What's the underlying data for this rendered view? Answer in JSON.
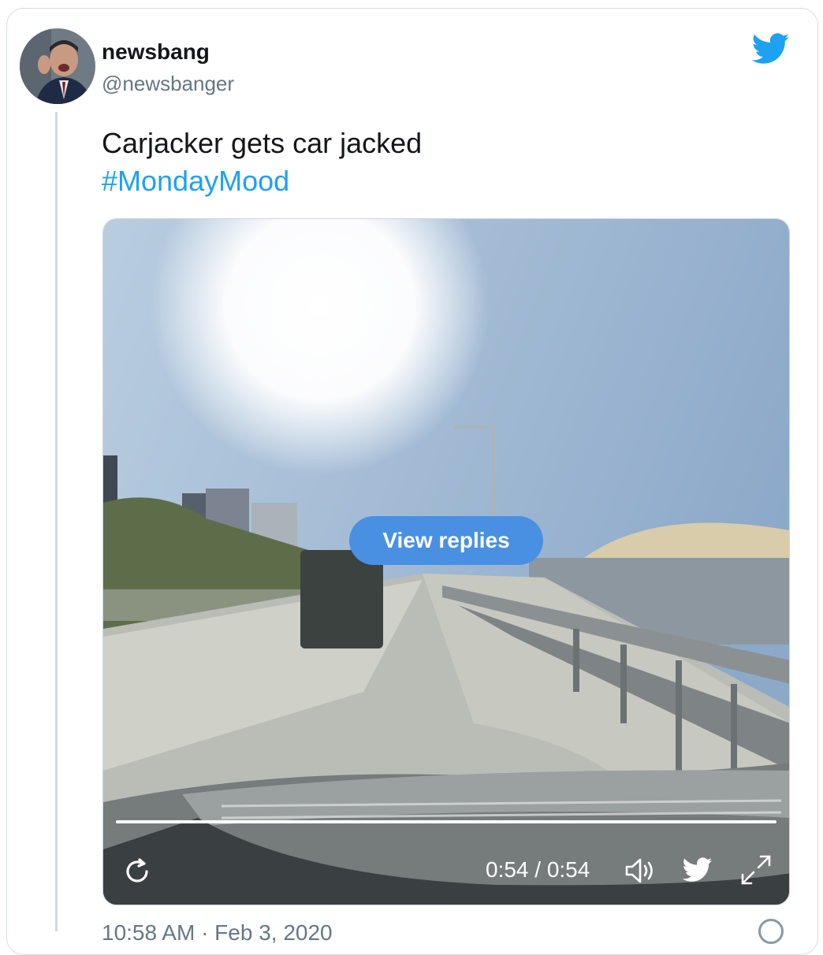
{
  "tweet": {
    "display_name": "newsbang",
    "handle": "@newsbanger",
    "text_line1": "Carjacker gets car jacked",
    "hashtag": "#MondayMood",
    "footer_peek": "10:58 AM · Feb 3, 2020"
  },
  "video": {
    "view_replies_label": "View replies",
    "time_display": "0:54 / 0:54",
    "progress": 1.0
  },
  "icons": {
    "brand": "twitter-bird-icon",
    "replay": "replay-icon",
    "volume": "volume-icon",
    "twitter_small": "twitter-bird-icon",
    "fullscreen": "fullscreen-icon",
    "info": "info-icon"
  },
  "colors": {
    "accent": "#1da1f2",
    "button": "#4a90e2",
    "secondary_text": "#657786"
  }
}
